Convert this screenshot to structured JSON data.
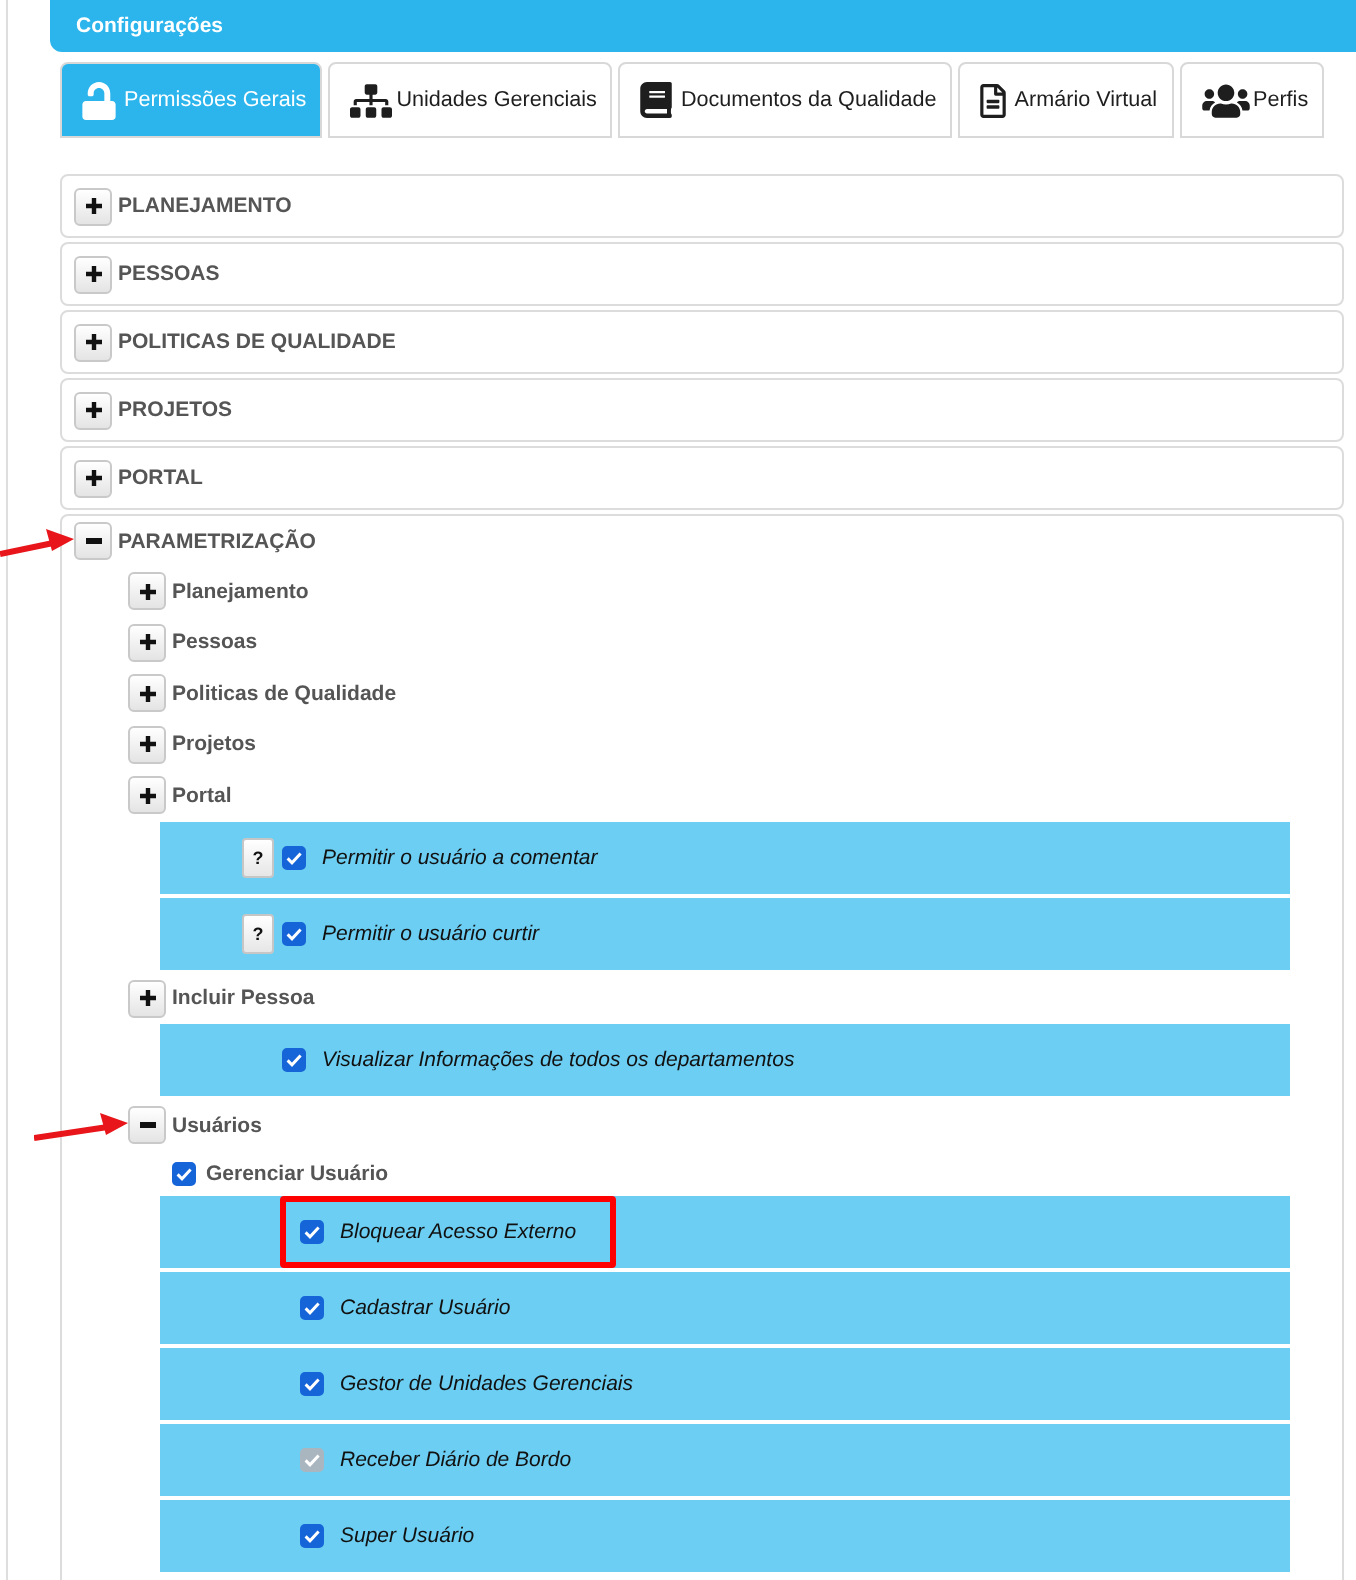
{
  "header": {
    "title": "Configurações"
  },
  "tabs": [
    {
      "label": "Permissões Gerais",
      "selected": true
    },
    {
      "label": "Unidades Gerenciais",
      "selected": false
    },
    {
      "label": "Documentos da Qualidade",
      "selected": false
    },
    {
      "label": "Armário Virtual",
      "selected": false
    },
    {
      "label": "Perfis",
      "selected": false
    }
  ],
  "sections": [
    {
      "label": "PLANEJAMENTO",
      "expanded": false,
      "annotated": false
    },
    {
      "label": "PESSOAS",
      "expanded": false,
      "annotated": false
    },
    {
      "label": "POLITICAS DE QUALIDADE",
      "expanded": false,
      "annotated": false
    },
    {
      "label": "PROJETOS",
      "expanded": false,
      "annotated": false
    },
    {
      "label": "PORTAL",
      "expanded": false,
      "annotated": false
    },
    {
      "label": "PARAMETRIZAÇÃO",
      "expanded": true,
      "annotated": true,
      "children": [
        {
          "kind": "group",
          "label": "Planejamento",
          "expanded": false,
          "annotated": false
        },
        {
          "kind": "group",
          "label": "Pessoas",
          "expanded": false,
          "annotated": false
        },
        {
          "kind": "group",
          "label": "Politicas de Qualidade",
          "expanded": false,
          "annotated": false
        },
        {
          "kind": "group",
          "label": "Projetos",
          "expanded": false,
          "annotated": false
        },
        {
          "kind": "group",
          "label": "Portal",
          "expanded": false,
          "annotated": false,
          "children": [
            {
              "kind": "permission",
              "label": "Permitir o usuário a comentar",
              "help": "?",
              "checked": true,
              "disabled": false,
              "highlighted": false
            },
            {
              "kind": "permission",
              "label": "Permitir o usuário curtir",
              "help": "?",
              "checked": true,
              "disabled": false,
              "highlighted": false
            }
          ]
        },
        {
          "kind": "group",
          "label": "Incluir Pessoa",
          "expanded": false,
          "annotated": false,
          "children": [
            {
              "kind": "permission",
              "label": "Visualizar Informações de todos os departamentos",
              "checked": true,
              "disabled": false,
              "highlighted": false
            }
          ]
        },
        {
          "kind": "group",
          "label": "Usuários",
          "expanded": true,
          "annotated": true,
          "children": [
            {
              "kind": "option",
              "label": "Gerenciar Usuário",
              "checked": true,
              "children": [
                {
                  "kind": "permission",
                  "label": "Bloquear Acesso Externo",
                  "checked": true,
                  "disabled": false,
                  "highlighted": true
                },
                {
                  "kind": "permission",
                  "label": "Cadastrar Usuário",
                  "checked": true,
                  "disabled": false,
                  "highlighted": false
                },
                {
                  "kind": "permission",
                  "label": "Gestor de Unidades Gerenciais",
                  "checked": true,
                  "disabled": false,
                  "highlighted": false
                },
                {
                  "kind": "permission",
                  "label": "Receber Diário de Bordo",
                  "checked": true,
                  "disabled": true,
                  "highlighted": false
                },
                {
                  "kind": "permission",
                  "label": "Super Usuário",
                  "checked": true,
                  "disabled": false,
                  "highlighted": false
                }
              ]
            }
          ]
        }
      ]
    }
  ]
}
